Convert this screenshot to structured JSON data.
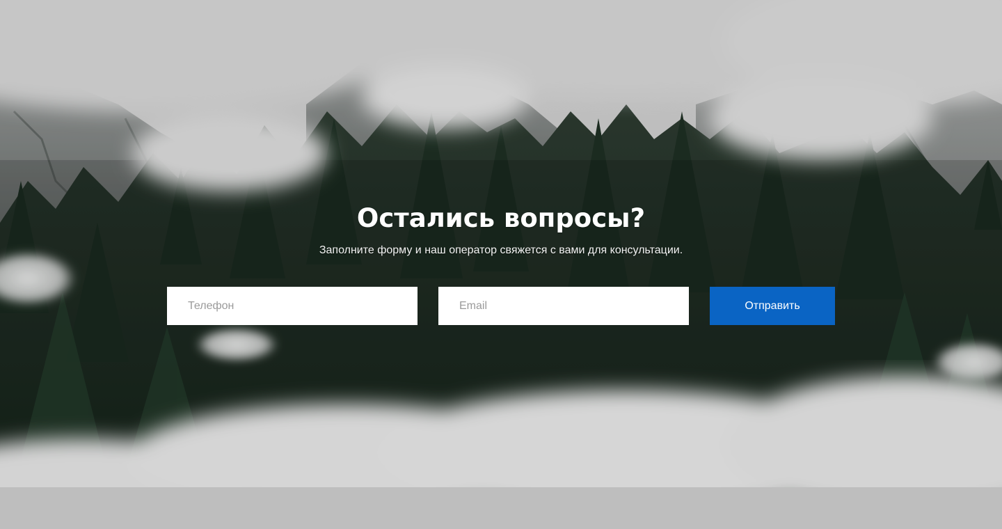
{
  "section": {
    "title": "Остались вопросы?",
    "subtitle": "Заполните форму и наш оператор свяжется с вами для консультации."
  },
  "form": {
    "phone_placeholder": "Телефон",
    "email_placeholder": "Email",
    "phone_value": "",
    "email_value": "",
    "submit_label": "Отправить"
  },
  "colors": {
    "accent": "#0a64c4",
    "background": "#d9d9d9",
    "field_background": "#ffffff"
  },
  "background_image": "mountain-forest-clouds-scene"
}
